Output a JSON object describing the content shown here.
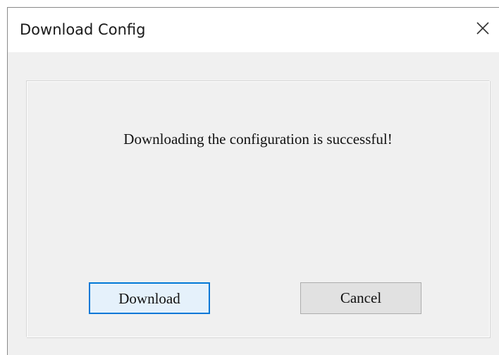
{
  "dialog": {
    "title": "Download Config",
    "close_icon": "close-icon",
    "message": "Downloading the configuration is successful!",
    "buttons": {
      "download_label": "Download",
      "cancel_label": "Cancel"
    }
  }
}
